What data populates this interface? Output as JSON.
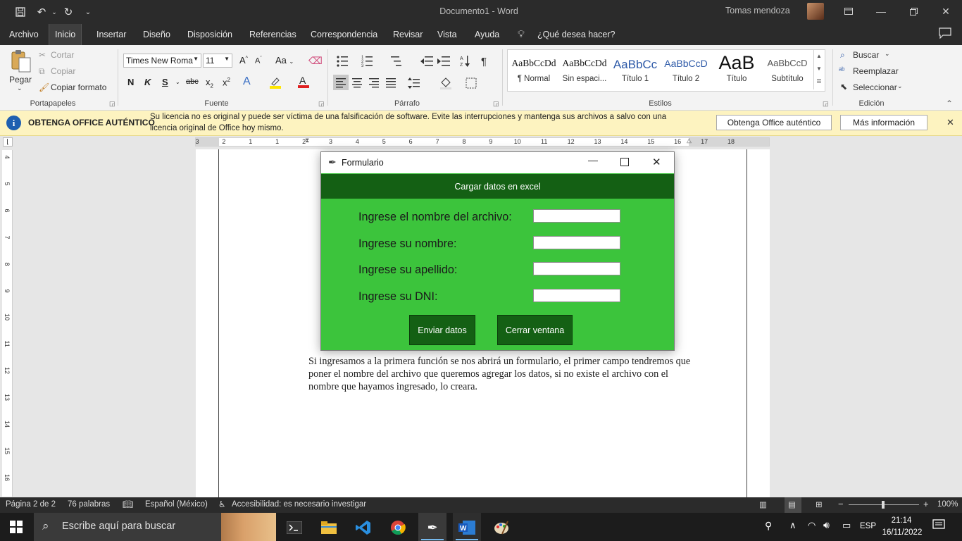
{
  "window": {
    "title": "Documento1  -  Word",
    "user": "Tomas mendoza"
  },
  "menu": [
    "Archivo",
    "Inicio",
    "Insertar",
    "Diseño",
    "Disposición",
    "Referencias",
    "Correspondencia",
    "Revisar",
    "Vista",
    "Ayuda"
  ],
  "tell_me": "¿Qué desea hacer?",
  "clipboard": {
    "paste": "Pegar",
    "cut": "Cortar",
    "copy": "Copiar",
    "format_painter": "Copiar formato",
    "group": "Portapapeles"
  },
  "font": {
    "name": "Times New Roma",
    "size": "11",
    "group": "Fuente",
    "aa": "Aa",
    "bold": "N",
    "italic": "K",
    "underline": "S",
    "strike": "abc"
  },
  "paragraph": {
    "group": "Párrafo"
  },
  "styles": {
    "group": "Estilos",
    "items": [
      {
        "sample": "AaBbCcDd",
        "name": "¶ Normal"
      },
      {
        "sample": "AaBbCcDd",
        "name": "Sin espaci..."
      },
      {
        "sample": "AaBbCc",
        "name": "Título 1"
      },
      {
        "sample": "AaBbCcD",
        "name": "Título 2"
      },
      {
        "sample": "AaB",
        "name": "Título"
      },
      {
        "sample": "AaBbCcD",
        "name": "Subtítulo"
      }
    ]
  },
  "editing": {
    "find": "Buscar",
    "replace": "Reemplazar",
    "select": "Seleccionar",
    "group": "Edición"
  },
  "notice": {
    "title": "OBTENGA OFFICE AUTÉNTICO",
    "line1": "Su licencia no es original y puede ser víctima de una falsificación de software. Evite las interrupciones y mantenga sus archivos a salvo con una",
    "line2": "licencia original de Office hoy mismo.",
    "btn_genuine": "Obtenga Office auténtico",
    "btn_more": "Más información"
  },
  "ruler": {
    "h_ticks": [
      "3",
      "2",
      "1",
      "1",
      "2",
      "3",
      "4",
      "5",
      "6",
      "7",
      "8",
      "9",
      "10",
      "11",
      "12",
      "13",
      "14",
      "15",
      "16",
      "17",
      "18"
    ],
    "v_ticks": [
      "4",
      "5",
      "6",
      "7",
      "8",
      "9",
      "10",
      "11",
      "12",
      "13",
      "14",
      "15",
      "16"
    ]
  },
  "dialog": {
    "title": "Formulario",
    "header": "Cargar datos en excel",
    "fields": [
      {
        "label": "Ingrese el nombre del archivo:",
        "value": ""
      },
      {
        "label": "Ingrese su nombre:",
        "value": ""
      },
      {
        "label": "Ingrese su apellido:",
        "value": ""
      },
      {
        "label": "Ingrese su DNI:",
        "value": ""
      }
    ],
    "submit": "Enviar datos",
    "close": "Cerrar ventana"
  },
  "document": {
    "text": "Si ingresamos a la primera función se nos abrirá un formulario, el primer campo tendremos que poner el nombre del archivo que queremos agregar los datos, si no existe el archivo con el nombre que hayamos ingresado, lo creara."
  },
  "status": {
    "page": "Página 2 de 2",
    "words": "76 palabras",
    "language": "Español (México)",
    "accessibility": "Accesibilidad: es necesario investigar",
    "zoom": "100%"
  },
  "taskbar": {
    "search": "Escribe aquí para buscar",
    "lang": "ESP",
    "time": "21:14",
    "date": "16/11/2022"
  },
  "colors": {
    "dialog_bg": "#3cc43c",
    "dialog_dark": "#146014",
    "notice_bg": "#fdf3c0",
    "titlebar": "#2b2b2b"
  }
}
